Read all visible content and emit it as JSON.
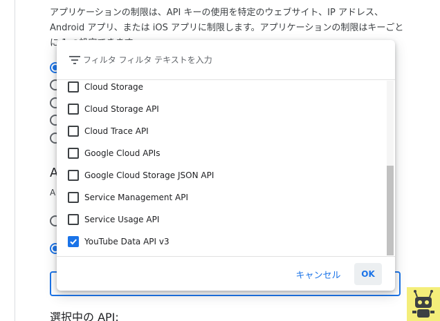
{
  "background": {
    "description": "アプリケーションの制限は、API キーの使用を特定のウェブサイト、IP アドレス、Android アプリ、または iOS アプリに制限します。アプリケーションの制限はキーごとに 1 つ設定できます",
    "heading_fragment": "A",
    "sub_fragment": "A",
    "selected_api_label": "選択中の API:"
  },
  "dialog": {
    "filter": {
      "icon": "filter-icon",
      "placeholder": "フィルタ フィルタ テキストを入力"
    },
    "options": [
      {
        "label": "Cloud Storage",
        "checked": false
      },
      {
        "label": "Cloud Storage API",
        "checked": false
      },
      {
        "label": "Cloud Trace API",
        "checked": false
      },
      {
        "label": "Google Cloud APIs",
        "checked": false
      },
      {
        "label": "Google Cloud Storage JSON API",
        "checked": false
      },
      {
        "label": "Service Management API",
        "checked": false
      },
      {
        "label": "Service Usage API",
        "checked": false
      },
      {
        "label": "YouTube Data API v3",
        "checked": true
      }
    ],
    "cancel_label": "キャンセル",
    "ok_label": "OK"
  },
  "colors": {
    "accent": "#1a73e8",
    "badge": "#f4ee7a"
  }
}
